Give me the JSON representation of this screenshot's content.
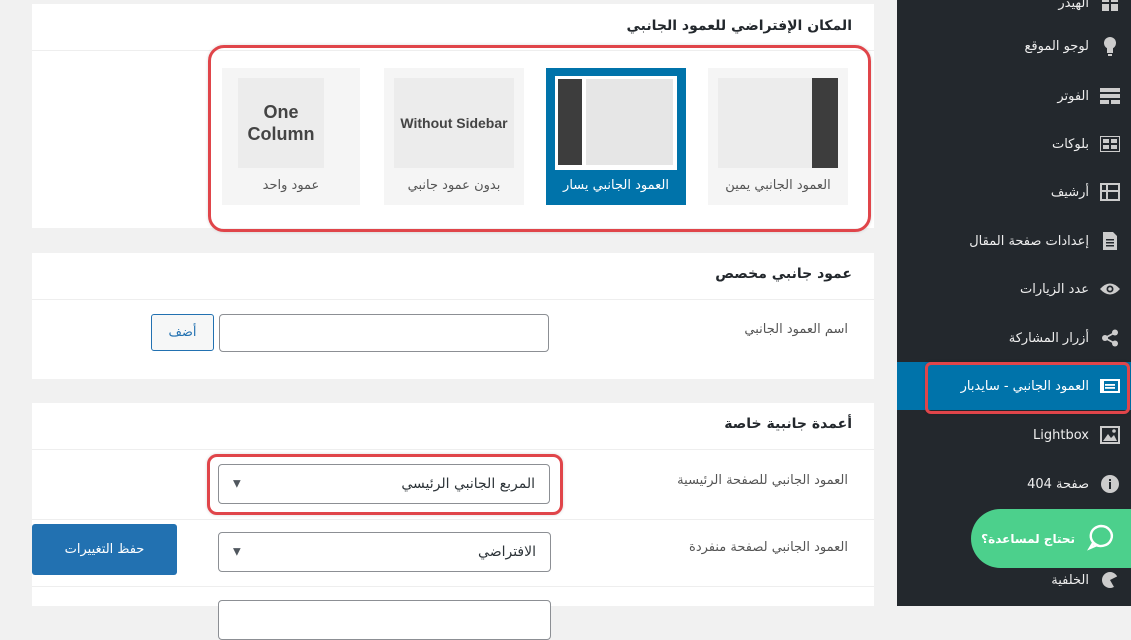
{
  "sidebar": {
    "items": [
      {
        "label": "الهيدر",
        "icon": "layout-icon"
      },
      {
        "label": "لوجو الموقع",
        "icon": "lightbulb-icon"
      },
      {
        "label": "الفوتر",
        "icon": "footer-icon"
      },
      {
        "label": "بلوكات",
        "icon": "blocks-icon"
      },
      {
        "label": "أرشيف",
        "icon": "archive-icon"
      },
      {
        "label": "إعدادات صفحة المقال",
        "icon": "document-icon"
      },
      {
        "label": "عدد الزيارات",
        "icon": "eye-icon"
      },
      {
        "label": "أزرار المشاركة",
        "icon": "share-icon"
      },
      {
        "label": "العمود الجانبي - سايدبار",
        "icon": "sidebar-icon",
        "active": true
      },
      {
        "label": "Lightbox",
        "icon": "image-icon"
      },
      {
        "label": "صفحة 404",
        "icon": "info-icon"
      },
      {
        "label": "الخلفية",
        "icon": "palette-icon"
      }
    ],
    "colors": {
      "bg": "#23282d",
      "active": "#0073aa"
    }
  },
  "help_bubble": {
    "label": "تحتاج لمساعدة؟",
    "icon": "chat-bubble-icon",
    "color": "#4cd08c"
  },
  "layout_panel": {
    "title": "المكان الإفتراضي للعمود الجانبي",
    "options": [
      {
        "caption": "العمود الجانبي يمين",
        "thumb": "sidebar-right"
      },
      {
        "caption": "العمود الجانبي يسار",
        "thumb": "sidebar-left",
        "selected": true
      },
      {
        "caption": "بدون عمود جانبي",
        "thumb_text": "Without Sidebar"
      },
      {
        "caption": "عمود واحد",
        "thumb_text": "One Column"
      }
    ]
  },
  "custom_sidebar": {
    "title": "عمود جانبي مخصص",
    "name_label": "اسم العمود الجانبي",
    "name_value": "",
    "add_button": "أضف"
  },
  "special_sidebars": {
    "title": "أعمدة جانبية خاصة",
    "rows": [
      {
        "label": "العمود الجانبي للصفحة الرئيسية",
        "selected": "المربع الجانبي الرئيسي"
      },
      {
        "label": "العمود الجانبي لصفحة منفردة",
        "selected": "الافتراضي"
      }
    ]
  },
  "save_button": "حفظ التغييرات",
  "accent": "#e0454a"
}
